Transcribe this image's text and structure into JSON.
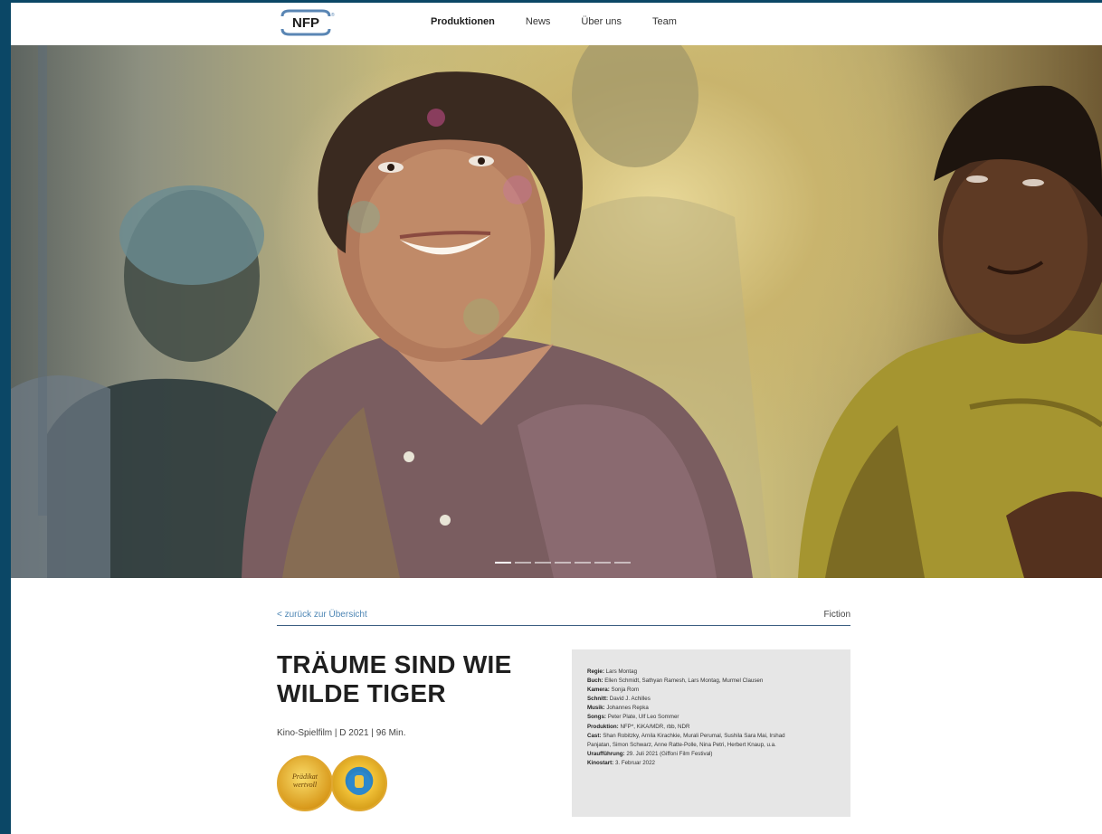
{
  "header": {
    "logo_text": "NFP",
    "nav": [
      {
        "label": "Produktionen",
        "active": true
      },
      {
        "label": "News",
        "active": false
      },
      {
        "label": "Über uns",
        "active": false
      },
      {
        "label": "Team",
        "active": false
      }
    ]
  },
  "hero": {
    "slide_count": 7,
    "active_slide": 1
  },
  "detail": {
    "back_link": "< zurück zur Übersicht",
    "genre": "Fiction",
    "title": "TRÄUME SIND WIE WILDE TIGER",
    "meta": "Kino-Spielfilm | D 2021 | 96 Min.",
    "badges": [
      {
        "name": "Prädikat wertvoll",
        "text": "Prädikat wertvoll"
      },
      {
        "name": "Jugend Filmjury",
        "text": ""
      }
    ],
    "credits": [
      {
        "label": "Regie:",
        "value": " Lars Montag"
      },
      {
        "label": "Buch:",
        "value": " Ellen Schmidt, Sathyan Ramesh, Lars Montag, Murmel Clausen"
      },
      {
        "label": "Kamera:",
        "value": " Sonja Rom"
      },
      {
        "label": "Schnitt:",
        "value": " David J. Achilles"
      },
      {
        "label": "Musik:",
        "value": " Johannes Repka"
      },
      {
        "label": "Songs:",
        "value": " Peter Plate, Ulf Leo Sommer"
      },
      {
        "label": "Produktion:",
        "value": " NFP*, KiKA/MDR, rbb, NDR"
      },
      {
        "label": "Cast:",
        "value": " Shan Robitzky, Arnila Kirachkie, Murali Perumal, Sushila Sara Mai, Irshad"
      },
      {
        "label": "",
        "value": "Panjatan, Simon Schwarz, Anne Ratte-Polle, Nina Petri, Herbert Knaup, u.a."
      },
      {
        "label": "Uraufführung:",
        "value": " 29. Juli 2021 (Giffoni Film Festival)"
      },
      {
        "label": "Kinostart:",
        "value": " 3. Februar 2022"
      }
    ]
  }
}
